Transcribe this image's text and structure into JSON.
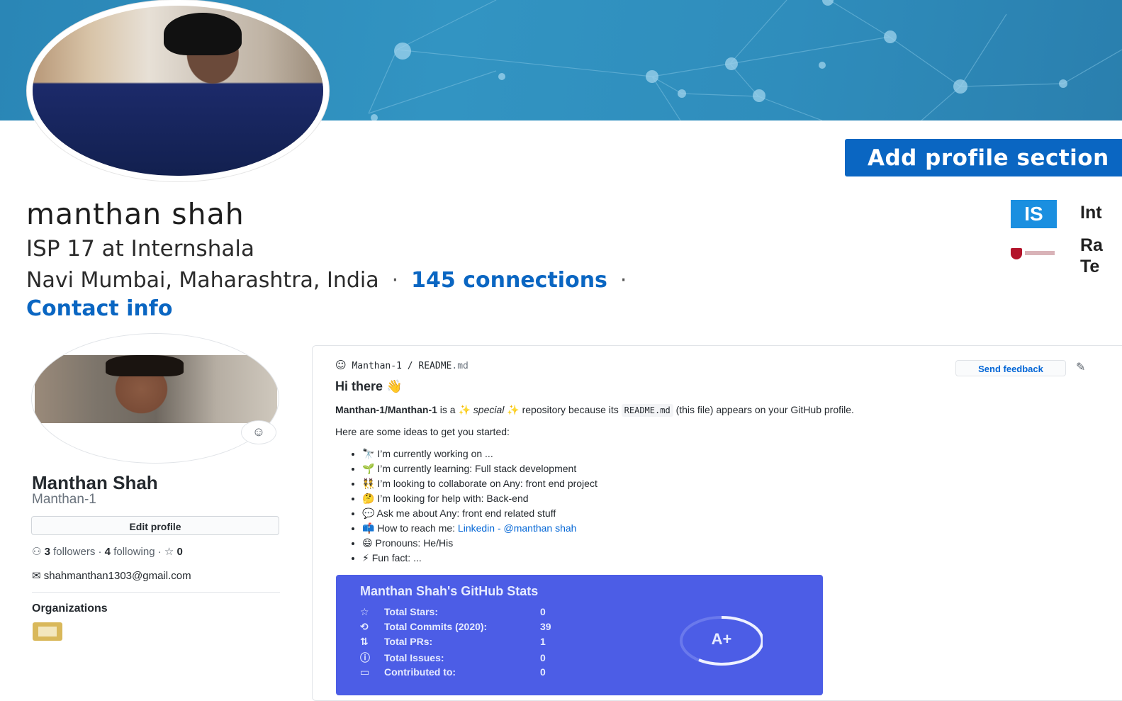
{
  "linkedin": {
    "name": "manthan shah",
    "headline": "ISP 17 at Internshala",
    "location": "Navi Mumbai, Maharashtra, India",
    "connections": "145 connections",
    "contact_info": "Contact info",
    "add_section_button": "Add profile section",
    "experience_badge": "IS",
    "experience_label": "Int",
    "education_line1": "Ra",
    "education_line2": "Te",
    "brand_color": "#0a66c2"
  },
  "github": {
    "name": "Manthan Shah",
    "login": "Manthan-1",
    "edit_profile": "Edit profile",
    "followers_count": "3",
    "followers_label": "followers",
    "following_count": "4",
    "following_label": "following",
    "stars_count": "0",
    "email": "shahmanthan1303@gmail.com",
    "organizations_heading": "Organizations"
  },
  "readme": {
    "path_owner": "Manthan-1",
    "path_sep": "/",
    "path_file": "README",
    "path_ext": ".md",
    "send_feedback": "Send feedback",
    "heading": "Hi there 👋",
    "intro_repo": "Manthan-1/Manthan-1",
    "intro_is_a": " is a ✨ ",
    "intro_special": "special",
    "intro_mid": " ✨ repository because its ",
    "intro_code": "README.md",
    "intro_end": " (this file) appears on your GitHub profile.",
    "ideas_text": "Here are some ideas to get you started:",
    "list": [
      "🔭 I’m currently working on ...",
      "🌱 I’m currently learning: Full stack development",
      "👯 I’m looking to collaborate on Any: front end project",
      "🤔 I’m looking for help with: Back-end",
      "💬 Ask me about Any: front end related stuff"
    ],
    "reach_prefix": "📫 How to reach me: ",
    "reach_link": "Linkedin - @manthan shah",
    "pronouns": "😄 Pronouns: He/His",
    "fun_fact": "⚡ Fun fact: ..."
  },
  "stats": {
    "title": "Manthan Shah's GitHub Stats",
    "rows": [
      {
        "icon": "star-icon",
        "glyph": "☆",
        "label": "Total Stars:",
        "value": "0"
      },
      {
        "icon": "history-icon",
        "glyph": "⟲",
        "label": "Total Commits (2020):",
        "value": "39"
      },
      {
        "icon": "pull-request-icon",
        "glyph": "⇅",
        "label": "Total PRs:",
        "value": "1"
      },
      {
        "icon": "issue-icon",
        "glyph": "ⓘ",
        "label": "Total Issues:",
        "value": "0"
      },
      {
        "icon": "repo-icon",
        "glyph": "▭",
        "label": "Contributed to:",
        "value": "0"
      }
    ],
    "rank": "A+",
    "card_color": "#4c5de6"
  }
}
